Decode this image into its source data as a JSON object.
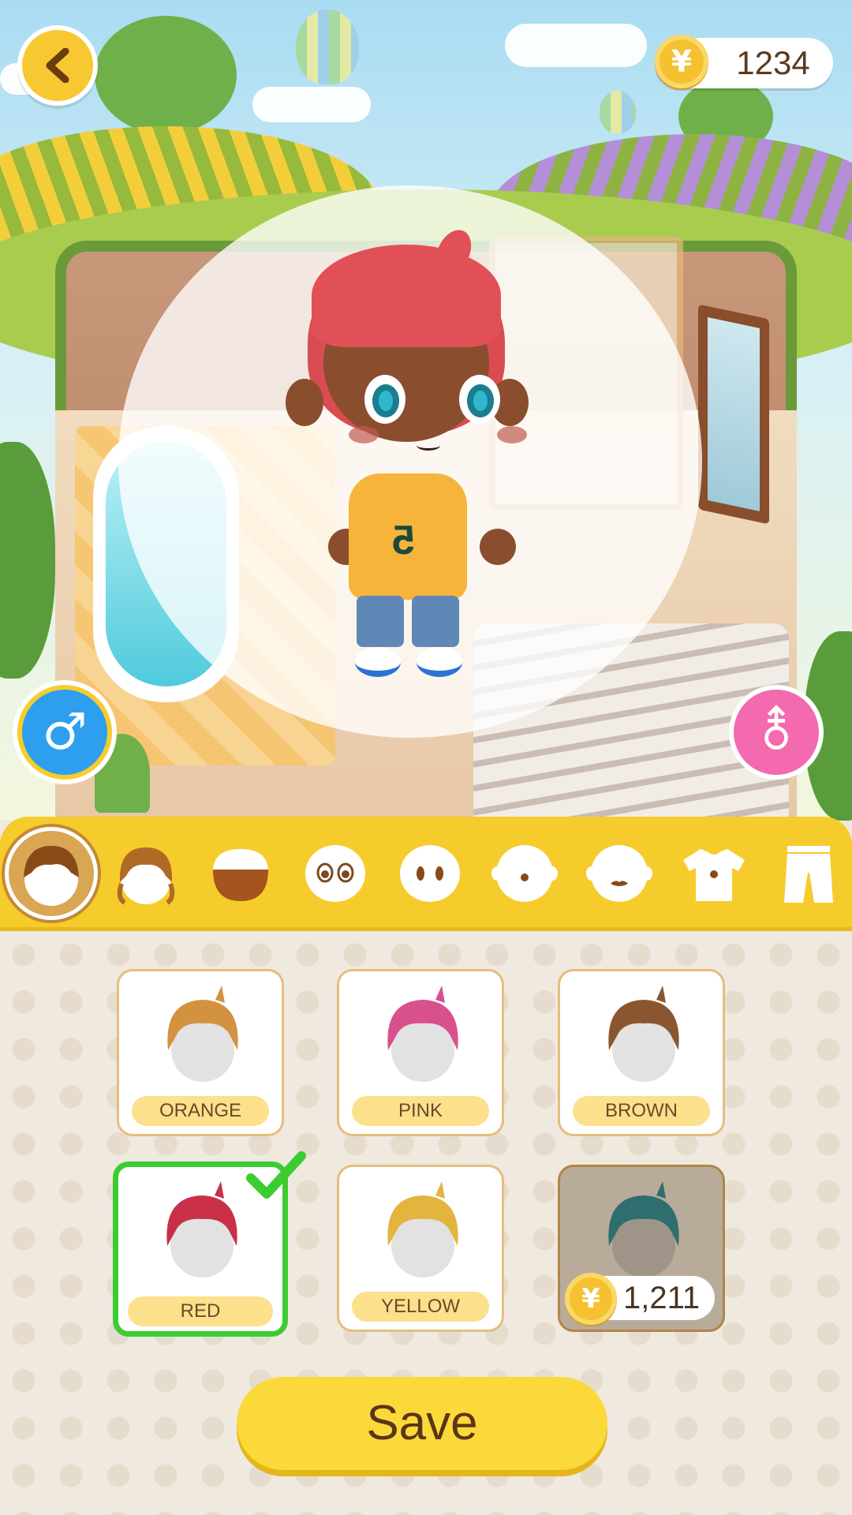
{
  "header": {
    "back_icon": "chevron-left-icon",
    "coin_icon": "yuan-coin-icon",
    "coin_glyph": "¥",
    "coin_balance": "1234"
  },
  "gender": {
    "male_glyph": "♂",
    "female_glyph": "⚨"
  },
  "categories": [
    {
      "icon": "hair-short-icon",
      "selected": true
    },
    {
      "icon": "hair-long-icon",
      "selected": false
    },
    {
      "icon": "skin-tone-icon",
      "selected": false
    },
    {
      "icon": "eyes-icon",
      "selected": false
    },
    {
      "icon": "ears-icon",
      "selected": false
    },
    {
      "icon": "nose-icon",
      "selected": false
    },
    {
      "icon": "mouth-icon",
      "selected": false
    },
    {
      "icon": "shirt-icon",
      "selected": false
    },
    {
      "icon": "pants-icon",
      "selected": false
    }
  ],
  "hair_options": [
    {
      "label": "ORANGE",
      "color": "#d2923f",
      "selected": false
    },
    {
      "label": "PINK",
      "color": "#d9508f",
      "selected": false
    },
    {
      "label": "BROWN",
      "color": "#8a5630",
      "selected": false
    },
    {
      "label": "RED",
      "color": "#c93048",
      "selected": true
    },
    {
      "label": "YELLOW",
      "color": "#e3b43e",
      "selected": false
    },
    {
      "label": "",
      "color": "#2e6e6e",
      "locked": true,
      "price": "1,211",
      "price_glyph": "¥"
    }
  ],
  "colors": {
    "accent_yellow": "#f6cb2c",
    "selected_green": "#3ccc32",
    "male_blue": "#2e9fef",
    "female_pink": "#f36aae",
    "character_hair": "#e25057"
  },
  "save_label": "Save"
}
